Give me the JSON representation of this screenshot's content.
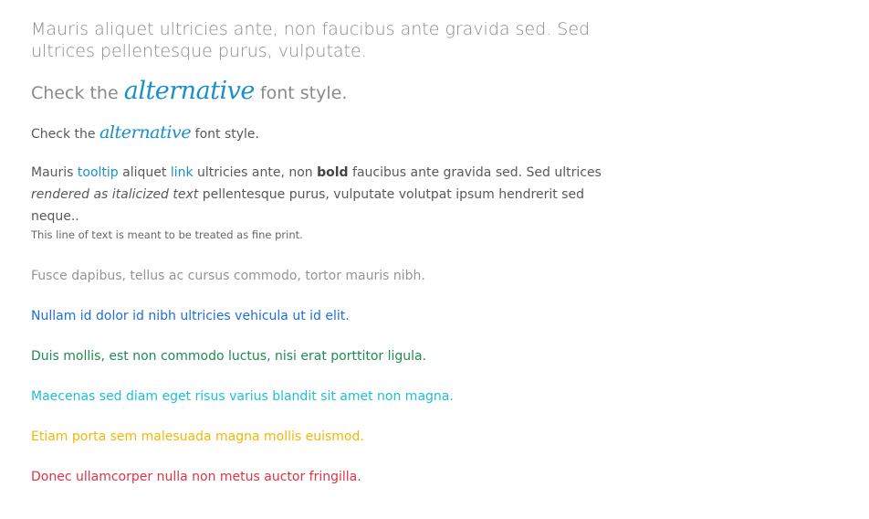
{
  "lead": {
    "text": "Mauris aliquet ultricies ante, non faucibus ante gravida sed. Sed ultrices pellentesque purus, vulputate."
  },
  "alt_large": {
    "prefix": "Check the",
    "word": "alternative",
    "suffix": "font style."
  },
  "alt_small": {
    "prefix": "Check the",
    "word": "alternative",
    "suffix": "font style."
  },
  "paragraph": {
    "t1": "Mauris ",
    "tooltip": "tooltip",
    "t2": " aliquet ",
    "link": "link",
    "t3": " ultricies ante, non ",
    "bold": "bold",
    "t4": " faucibus ante gravida sed. Sed ultrices ",
    "italic": "rendered as italicized text",
    "t5": " pellentesque purus, vulputate volutpat ipsum hendrerit sed neque.."
  },
  "fine_print": "This line of text is meant to be treated as fine print.",
  "text_lines": {
    "muted": "Fusce dapibus, tellus ac cursus commodo, tortor mauris nibh.",
    "primary": "Nullam id dolor id nibh ultricies vehicula ut id elit.",
    "success": "Duis mollis, est non commodo luctus, nisi erat porttitor ligula.",
    "info": "Maecenas sed diam eget risus varius blandit sit amet non magna.",
    "warning": "Etiam porta sem malesuada magna mollis euismod.",
    "danger": "Donec ullamcorper nulla non metus auctor fringilla."
  },
  "colors": {
    "accent": "#1a8fc7",
    "muted": "#949494",
    "primary": "#1d6fd6",
    "success": "#1e8a55",
    "info": "#1dbfd8",
    "warning": "#f2b705",
    "danger": "#db3545"
  }
}
